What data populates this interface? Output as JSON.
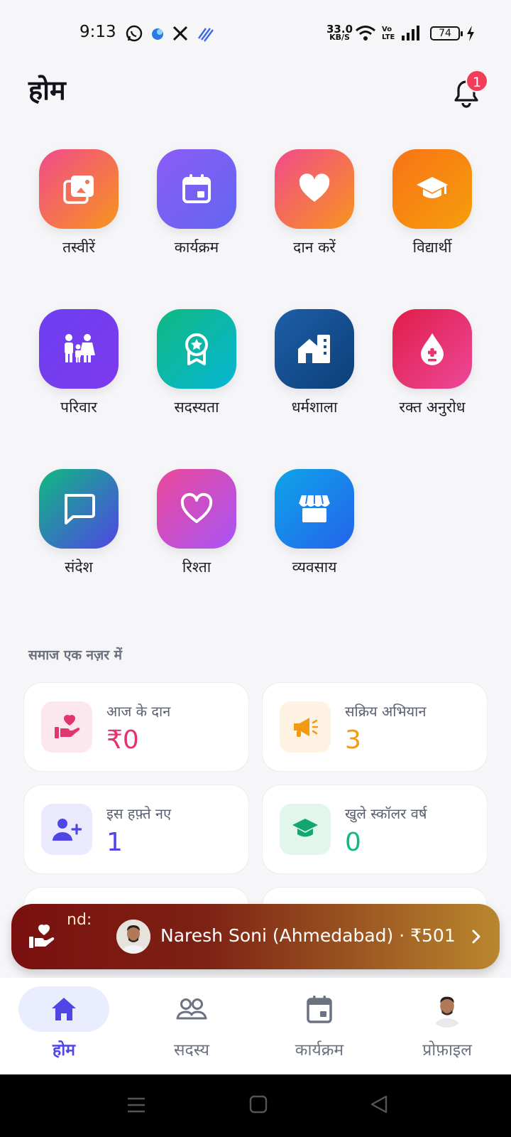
{
  "status_bar": {
    "time": "9:13",
    "net_speed_value": "33.0",
    "net_speed_unit": "KB/S",
    "volte": "Vo LTE",
    "battery": "74"
  },
  "header": {
    "title": "होम",
    "notification_count": "1"
  },
  "grid": [
    {
      "label": "तस्वीरें",
      "icon": "gallery-icon"
    },
    {
      "label": "कार्यक्रम",
      "icon": "calendar-icon"
    },
    {
      "label": "दान करें",
      "icon": "heart-icon"
    },
    {
      "label": "विद्यार्थी",
      "icon": "graduation-cap-icon"
    },
    {
      "label": "परिवार",
      "icon": "family-icon"
    },
    {
      "label": "सदस्यता",
      "icon": "award-badge-icon"
    },
    {
      "label": "धर्मशाला",
      "icon": "building-icon"
    },
    {
      "label": "रक्त अनुरोध",
      "icon": "blood-drop-icon"
    },
    {
      "label": "संदेश",
      "icon": "message-icon"
    },
    {
      "label": "रिश्ता",
      "icon": "heart-outline-icon"
    },
    {
      "label": "व्यवसाय",
      "icon": "store-icon"
    }
  ],
  "overview": {
    "section_title": "समाज एक नज़र में",
    "cards": [
      {
        "title": "आज के दान",
        "value": "₹0",
        "color": "#e0356f",
        "icon": "donation-hand-icon"
      },
      {
        "title": "सक्रिय अभियान",
        "value": "3",
        "color": "#f39a14",
        "icon": "megaphone-icon"
      },
      {
        "title": "इस हफ़्ते नए",
        "value": "1",
        "color": "#4f46e5",
        "icon": "add-user-icon"
      },
      {
        "title": "खुले स्कॉलर वर्ष",
        "value": "0",
        "color": "#10b981",
        "icon": "graduation-cap-icon"
      }
    ]
  },
  "banner": {
    "prefix": "nd:",
    "text": "Naresh Soni (Ahmedabad) · ₹501",
    "icon": "donation-hand-icon"
  },
  "bottom_nav": [
    {
      "label": "होम",
      "icon": "home-icon",
      "active": true
    },
    {
      "label": "सदस्य",
      "icon": "members-icon",
      "active": false
    },
    {
      "label": "कार्यक्रम",
      "icon": "calendar-icon",
      "active": false
    },
    {
      "label": "प्रोफ़ाइल",
      "icon": "avatar",
      "active": false
    }
  ],
  "colors": {
    "accent": "#4f46e5",
    "background": "#f6f6f8"
  }
}
